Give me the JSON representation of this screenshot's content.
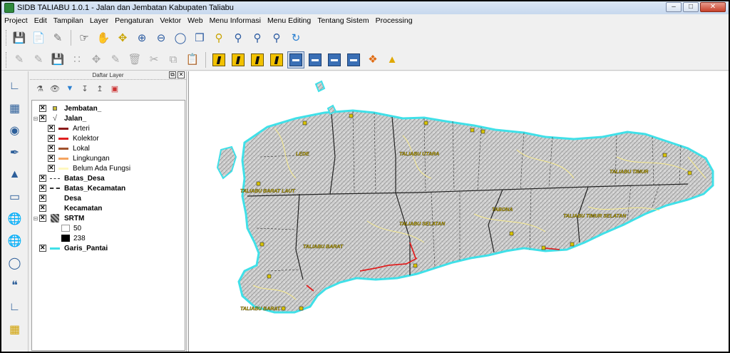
{
  "window": {
    "title": "SIDB TALIABU  1.0.1 - Jalan dan Jembatan Kabupaten Taliabu"
  },
  "menubar": [
    "Project",
    "Edit",
    "Tampilan",
    "Layer",
    "Pengaturan",
    "Vektor",
    "Web",
    "Menu Informasi",
    "Menu Editing",
    "Tentang Sistem",
    "Processing"
  ],
  "layer_panel": {
    "title": "Daftar Layer",
    "layers": [
      {
        "label": "Jembatan_",
        "checked": true,
        "symbol": "square"
      },
      {
        "label": "Jalan_",
        "checked": true,
        "symbol": "line-category",
        "categories": [
          {
            "label": "Arteri",
            "color": "#8b1a1a"
          },
          {
            "label": "Kolektor",
            "color": "#e02020"
          },
          {
            "label": "Lokal",
            "color": "#a0522d"
          },
          {
            "label": "Lingkungan",
            "color": "#f4a460"
          },
          {
            "label": "Belum Ada Fungsi",
            "color": "#fff8c0"
          }
        ]
      },
      {
        "label": "Batas_Desa",
        "checked": true,
        "symbol": "dash"
      },
      {
        "label": "Batas_Kecamatan",
        "checked": true,
        "symbol": "dashdot"
      },
      {
        "label": "Desa",
        "checked": true,
        "symbol": "none"
      },
      {
        "label": "Kecamatan",
        "checked": true,
        "symbol": "none"
      },
      {
        "label": "SRTM",
        "checked": true,
        "symbol": "raster",
        "ramp": {
          "low": "50",
          "high": "238"
        }
      },
      {
        "label": "Garis_Pantai",
        "checked": true,
        "symbol": "cyan-line"
      }
    ]
  },
  "map": {
    "labels": [
      "LEDE",
      "TALIABU UTARA",
      "TALIABU TIMUR",
      "TALIABU BARAT LAUT",
      "TALIABU SELATAN",
      "TABONA",
      "TALIABU TIMUR SELATAN",
      "TALIABU BARAT",
      "TALIABU BARAT"
    ],
    "colors": {
      "coast": "#40e0e8",
      "island": "#c9c9c9",
      "road_local": "#f6e98a",
      "road_kolektor": "#e02020",
      "boundary": "#222222",
      "bridge": "#d9c400"
    }
  }
}
